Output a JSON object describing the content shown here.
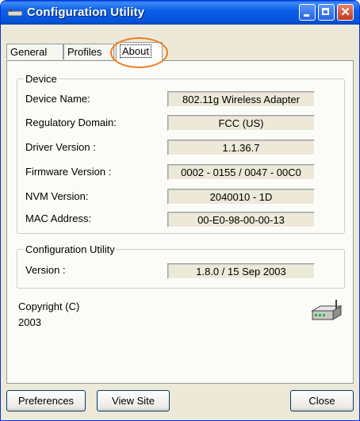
{
  "window": {
    "title": "Configuration Utility"
  },
  "tabs": [
    {
      "label": "General"
    },
    {
      "label": "Profiles"
    },
    {
      "label": "About",
      "selected": true
    }
  ],
  "device": {
    "group_title": "Device",
    "fields": [
      {
        "label": "Device Name:",
        "value": "802.11g Wireless Adapter"
      },
      {
        "label": "Regulatory Domain:",
        "value": "FCC (US)"
      },
      {
        "label": "Driver Version :",
        "value": "1.1.36.7"
      },
      {
        "label": "Firmware Version :",
        "value": "0002 - 0155 / 0047 - 00C0"
      },
      {
        "label": "NVM Version:",
        "value": "2040010 - 1D"
      },
      {
        "label": "MAC Address:",
        "value": "00-E0-98-00-00-13"
      }
    ]
  },
  "config_utility": {
    "group_title": "Configuration Utility",
    "version_label": "Version :",
    "version_value": "1.8.0 / 15 Sep 2003"
  },
  "copyright": {
    "line1": "Copyright (C)",
    "line2": "2003"
  },
  "buttons": {
    "preferences": "Preferences",
    "view_site": "View Site",
    "close": "Close"
  },
  "icons": {
    "title": "network-adapter-icon",
    "router": "router-icon"
  },
  "colors": {
    "titlebar": "#0a5fe8",
    "highlight": "#f07d1e",
    "face": "#ece9d8"
  }
}
